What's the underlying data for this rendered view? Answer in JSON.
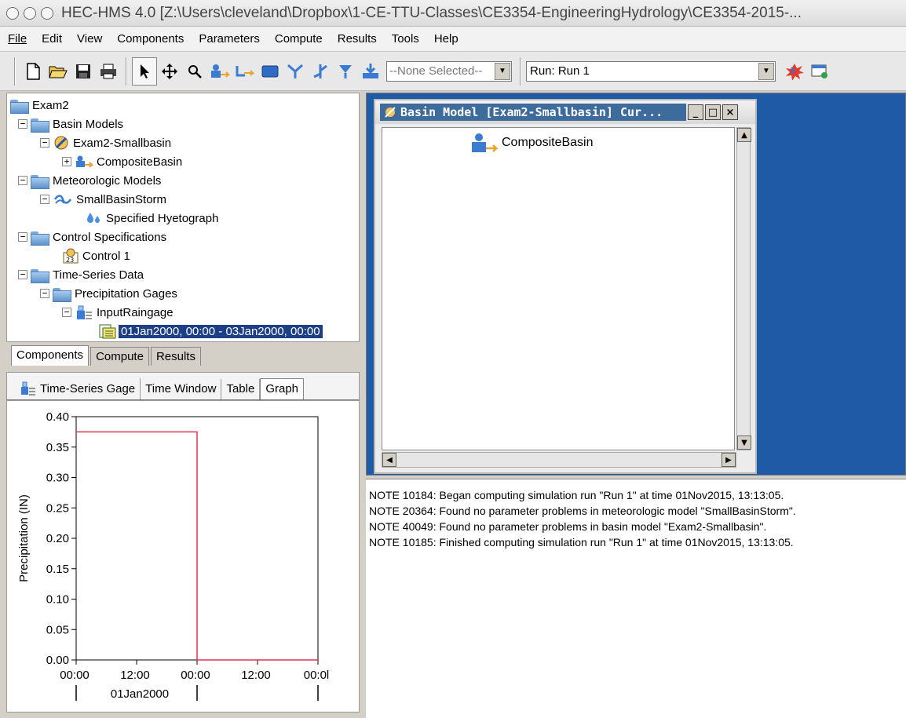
{
  "window": {
    "title": "HEC-HMS 4.0 [Z:\\Users\\cleveland\\Dropbox\\1-CE-TTU-Classes\\CE3354-EngineeringHydrology\\CE3354-2015-..."
  },
  "menu": [
    "File",
    "Edit",
    "View",
    "Components",
    "Parameters",
    "Compute",
    "Results",
    "Tools",
    "Help"
  ],
  "toolbar": {
    "element_selector": "--None Selected--",
    "run_selector": "Run: Run 1"
  },
  "tree": {
    "root": "Exam2",
    "basin_models": "Basin Models",
    "basin": "Exam2-Smallbasin",
    "element": "CompositeBasin",
    "met_models": "Meteorologic Models",
    "met": "SmallBasinStorm",
    "hyeto": "Specified Hyetograph",
    "control_specs": "Control Specifications",
    "control": "Control 1",
    "ts_data": "Time-Series Data",
    "precip_gages": "Precipitation Gages",
    "gage": "InputRaingage",
    "window": "01Jan2000, 00:00 - 03Jan2000, 00:00"
  },
  "tabs": [
    "Components",
    "Compute",
    "Results"
  ],
  "subtabs": [
    "Time-Series Gage",
    "Time Window",
    "Table",
    "Graph"
  ],
  "chart_data": {
    "type": "line",
    "ylabel": "Precipitation (IN)",
    "xlabel": "",
    "ylim": [
      0.0,
      0.4
    ],
    "yticks": [
      "0.00",
      "0.05",
      "0.10",
      "0.15",
      "0.20",
      "0.25",
      "0.30",
      "0.35",
      "0.40"
    ],
    "xticks": [
      "00:00",
      "12:00",
      "00:00",
      "12:00",
      "00:0l"
    ],
    "date_label": "01Jan2000",
    "series": [
      {
        "color": "#e0334f",
        "x": [
          "01Jan2000 00:00",
          "02Jan2000 00:00",
          "02Jan2000 00:00",
          "03Jan2000 00:00"
        ],
        "y": [
          0.375,
          0.375,
          0.0,
          0.0
        ]
      }
    ],
    "grid": false
  },
  "basin_window": {
    "title": "Basin Model [Exam2-Smallbasin]  Cur...",
    "element_label": "CompositeBasin"
  },
  "messages": [
    "NOTE 10184:  Began computing simulation run \"Run 1\" at time 01Nov2015, 13:13:05.",
    "NOTE 20364:  Found no parameter problems in meteorologic model \"SmallBasinStorm\".",
    "NOTE 40049:  Found no parameter problems in basin model \"Exam2-Smallbasin\".",
    "NOTE 10185:  Finished computing simulation run \"Run 1\" at time 01Nov2015, 13:13:05."
  ],
  "colors": {
    "desktop": "#1e5aa5",
    "selection": "#1d3f86",
    "series": "#e0334f"
  }
}
